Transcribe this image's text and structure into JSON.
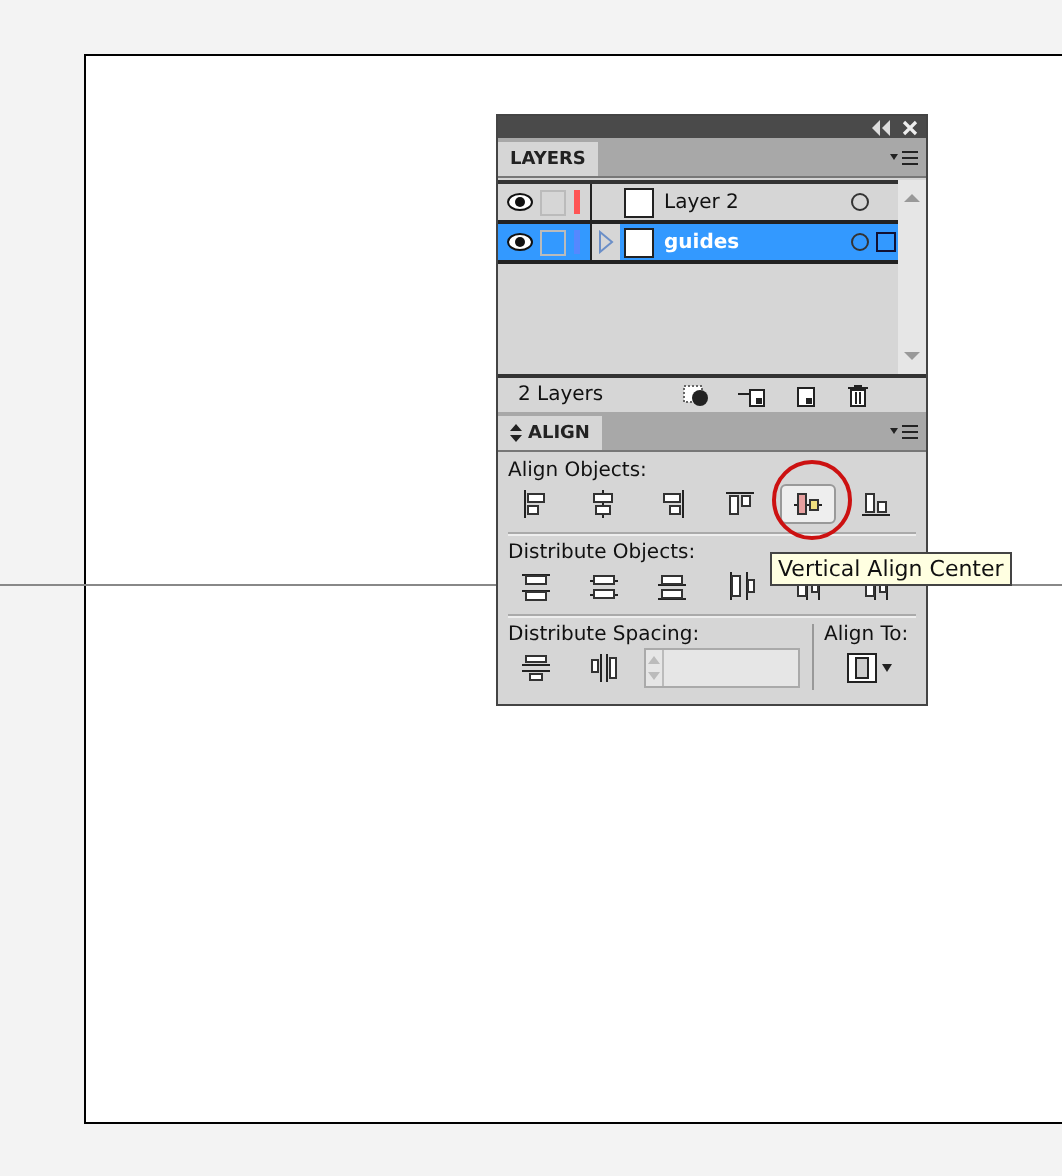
{
  "layers_panel": {
    "tab": "LAYERS",
    "rows": [
      {
        "name": "Layer 2",
        "selected": false,
        "color": "#ff5555",
        "expandable": false
      },
      {
        "name": "guides",
        "selected": true,
        "color": "#5588ff",
        "expandable": true
      }
    ],
    "count": "2 Layers"
  },
  "align_panel": {
    "tab": "ALIGN",
    "align_objects_label": "Align Objects:",
    "align_objects": [
      {
        "hovered": false
      },
      {
        "hovered": false
      },
      {
        "hovered": false
      },
      {
        "hovered": false
      },
      {
        "hovered": true
      },
      {
        "hovered": false
      }
    ],
    "distribute_objects_label": "Distribute Objects:",
    "distribute_spacing_label": "Distribute Spacing:",
    "align_to_label": "Align To:"
  },
  "tooltip": "Vertical Align Center"
}
